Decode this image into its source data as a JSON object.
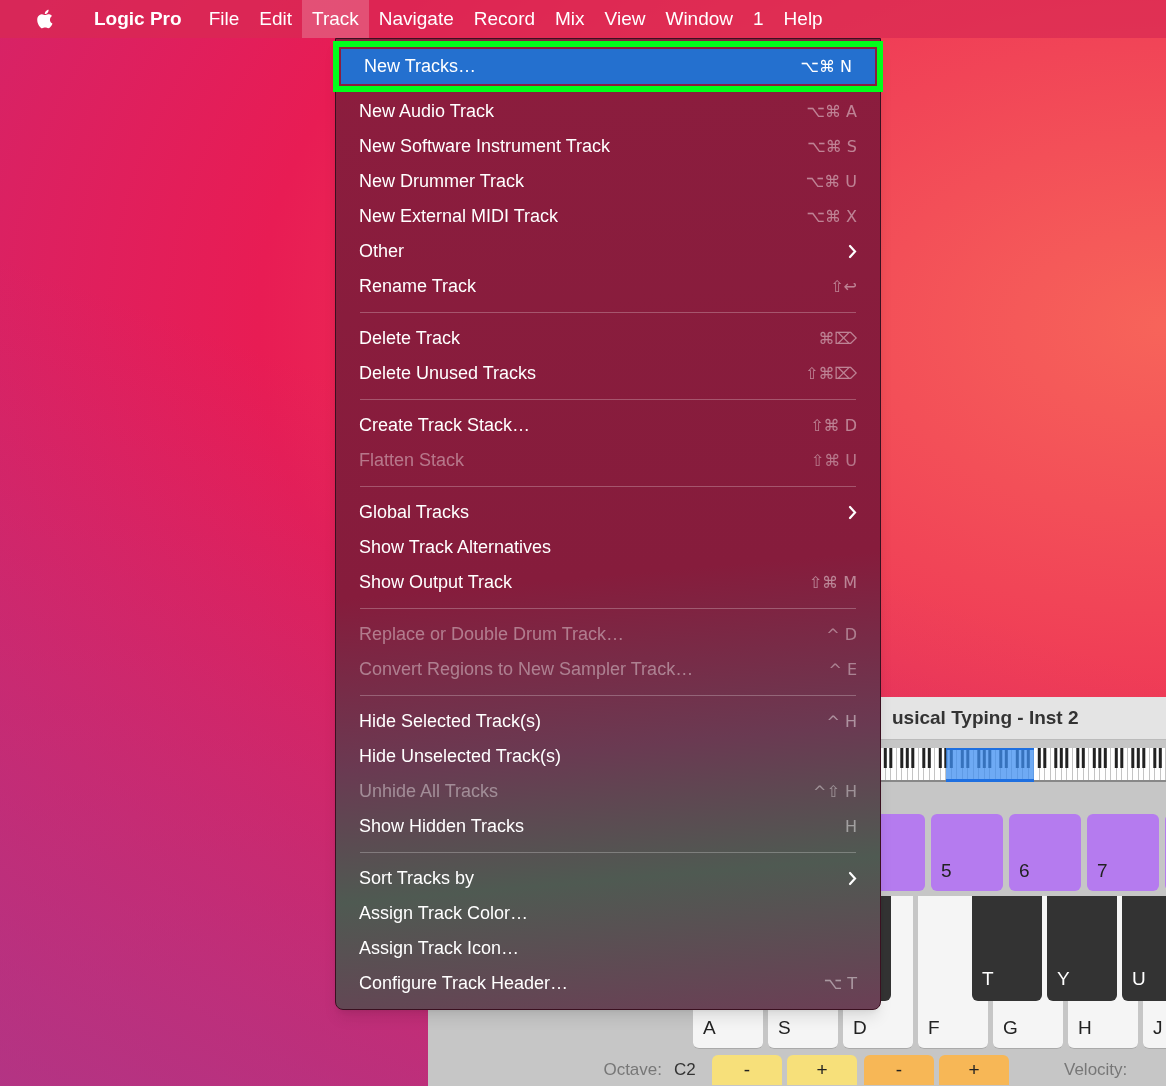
{
  "menu_bar": {
    "app_name": "Logic Pro",
    "menus": [
      {
        "label": "File",
        "selected": false
      },
      {
        "label": "Edit",
        "selected": false
      },
      {
        "label": "Track",
        "selected": true
      },
      {
        "label": "Navigate",
        "selected": false
      },
      {
        "label": "Record",
        "selected": false
      },
      {
        "label": "Mix",
        "selected": false
      },
      {
        "label": "View",
        "selected": false
      },
      {
        "label": "Window",
        "selected": false
      },
      {
        "label": "1",
        "selected": false
      },
      {
        "label": "Help",
        "selected": false
      }
    ]
  },
  "track_menu": {
    "items": [
      {
        "kind": "item",
        "label": "New Tracks…",
        "shortcut": "⌥⌘ N",
        "selected": true,
        "disabled": false,
        "submenu": false
      },
      {
        "kind": "item",
        "label": "New Audio Track",
        "shortcut": "⌥⌘ A",
        "selected": false,
        "disabled": false,
        "submenu": false
      },
      {
        "kind": "item",
        "label": "New Software Instrument Track",
        "shortcut": "⌥⌘ S",
        "selected": false,
        "disabled": false,
        "submenu": false
      },
      {
        "kind": "item",
        "label": "New Drummer Track",
        "shortcut": "⌥⌘ U",
        "selected": false,
        "disabled": false,
        "submenu": false
      },
      {
        "kind": "item",
        "label": "New External MIDI Track",
        "shortcut": "⌥⌘ X",
        "selected": false,
        "disabled": false,
        "submenu": false
      },
      {
        "kind": "item",
        "label": "Other",
        "selected": false,
        "disabled": false,
        "submenu": true
      },
      {
        "kind": "item",
        "label": "Rename Track",
        "shortcut": "⇧↩",
        "selected": false,
        "disabled": false,
        "submenu": false
      },
      {
        "kind": "separator"
      },
      {
        "kind": "item",
        "label": "Delete Track",
        "shortcut": "⌘⌦",
        "selected": false,
        "disabled": false,
        "submenu": false
      },
      {
        "kind": "item",
        "label": "Delete Unused Tracks",
        "shortcut": "⇧⌘⌦",
        "selected": false,
        "disabled": false,
        "submenu": false
      },
      {
        "kind": "separator"
      },
      {
        "kind": "item",
        "label": "Create Track Stack…",
        "shortcut": "⇧⌘ D",
        "selected": false,
        "disabled": false,
        "submenu": false
      },
      {
        "kind": "item",
        "label": "Flatten Stack",
        "shortcut": "⇧⌘ U",
        "selected": false,
        "disabled": true,
        "submenu": false
      },
      {
        "kind": "separator"
      },
      {
        "kind": "item",
        "label": "Global Tracks",
        "selected": false,
        "disabled": false,
        "submenu": true
      },
      {
        "kind": "item",
        "label": "Show Track Alternatives",
        "selected": false,
        "disabled": false,
        "submenu": false
      },
      {
        "kind": "item",
        "label": "Show Output Track",
        "shortcut": "⇧⌘ M",
        "selected": false,
        "disabled": false,
        "submenu": false
      },
      {
        "kind": "separator"
      },
      {
        "kind": "item",
        "label": "Replace or Double Drum Track…",
        "shortcut": "^ D",
        "selected": false,
        "disabled": true,
        "submenu": false
      },
      {
        "kind": "item",
        "label": "Convert Regions to New Sampler Track…",
        "shortcut": "^ E",
        "selected": false,
        "disabled": true,
        "submenu": false
      },
      {
        "kind": "separator"
      },
      {
        "kind": "item",
        "label": "Hide Selected Track(s)",
        "shortcut": "^ H",
        "selected": false,
        "disabled": false,
        "submenu": false
      },
      {
        "kind": "item",
        "label": "Hide Unselected Track(s)",
        "selected": false,
        "disabled": false,
        "submenu": false
      },
      {
        "kind": "item",
        "label": "Unhide All Tracks",
        "shortcut": "^⇧ H",
        "selected": false,
        "disabled": true,
        "submenu": false
      },
      {
        "kind": "item",
        "label": "Show Hidden Tracks",
        "shortcut": "H",
        "selected": false,
        "disabled": false,
        "submenu": false
      },
      {
        "kind": "separator"
      },
      {
        "kind": "item",
        "label": "Sort Tracks by",
        "selected": false,
        "disabled": false,
        "submenu": true
      },
      {
        "kind": "item",
        "label": "Assign Track Color…",
        "selected": false,
        "disabled": false,
        "submenu": false
      },
      {
        "kind": "item",
        "label": "Assign Track Icon…",
        "selected": false,
        "disabled": false,
        "submenu": false
      },
      {
        "kind": "item",
        "label": "Configure Track Header…",
        "shortcut": "⌥ T",
        "selected": false,
        "disabled": false,
        "submenu": false
      }
    ]
  },
  "musical_typing": {
    "title": "usical Typing - Inst 2",
    "number_keys": [
      "5",
      "6",
      "7"
    ],
    "black_keys": [
      "T",
      "Y",
      "U"
    ],
    "white_keys": [
      "A",
      "S",
      "D",
      "F",
      "G",
      "H",
      "J"
    ],
    "octave_label": "Octave:",
    "octave_value": "C2",
    "octave_buttons": [
      "-",
      "+"
    ],
    "velocity_buttons": [
      "-",
      "+"
    ],
    "velocity_label": "Velocity:"
  }
}
